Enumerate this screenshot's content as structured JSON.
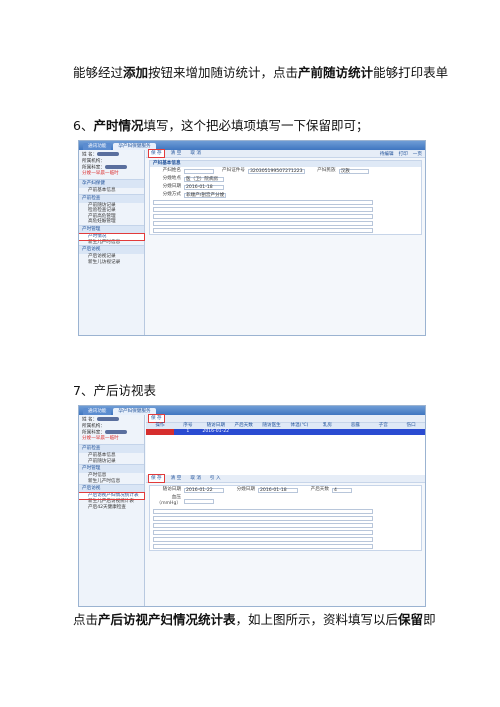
{
  "paragraphs": {
    "p1": {
      "a": "能够经过",
      "b": "添加",
      "c": "按钮来增加随访统计，点击",
      "d": "产前随访统计",
      "e": "能够打印表单"
    },
    "p2": {
      "a": "6、",
      "b": "产时情况",
      "c": "填写，这个把必填项填写一下保留即可；"
    },
    "p3": {
      "a": "7、产后访视表"
    },
    "p4": {
      "a": "点击",
      "b": "产后访视产妇情况统计表",
      "c": "，如上图所示，资料填写以后",
      "d": "保留",
      "e": "即"
    }
  },
  "screenshot1": {
    "tabs": [
      "通讯功能",
      "孕产妇保健服务"
    ],
    "user_lines": [
      "姓   名：",
      "所属机构：",
      "所属科室：",
      "分娩一早晨一临时"
    ],
    "side_heads": [
      "孕产妇保健",
      "产前检查",
      "产时管理",
      "产后访视"
    ],
    "side_items": [
      "产前基本信息",
      "产前随访记录",
      "检验检查记录",
      "产前高危管理",
      "高危妊娠管理",
      "产时信息",
      "产后访视记录",
      "新生儿产时信息",
      "新生儿访视记录"
    ],
    "highlight_item": "产时情况",
    "toolbar": [
      "保 存",
      "清 空",
      "取 消"
    ],
    "topright": [
      "待编辑",
      "打印",
      "一页"
    ],
    "section_title": "产妇基本信息",
    "fields": [
      {
        "label": "产妇姓名",
        "value": ""
      },
      {
        "label": "产妇证件号",
        "value": "320305199507271223"
      },
      {
        "label": "产妇民族",
        "value": "汉族"
      },
      {
        "label": "分娩地点",
        "value": "医（卫）院病房"
      },
      {
        "label": "分娩日期",
        "value": "2016-01-18"
      },
      {
        "label": "分娩方式",
        "value": "非顺产/剖宫产分娩"
      }
    ]
  },
  "screenshot2": {
    "tabs": [
      "通讯功能",
      "孕产妇保健服务"
    ],
    "grid_headers": [
      "操作",
      "序号",
      "随访日期",
      "产后天数",
      "随访医生",
      "体温(℃)",
      "乳房",
      "恶露",
      "子宫",
      "伤口"
    ],
    "grid_row": [
      "",
      "1",
      "2016-01-22",
      "",
      "",
      "",
      "",
      "",
      "",
      ""
    ],
    "toolbar": [
      "保 存",
      "清 空",
      "取 消",
      "引 入"
    ],
    "side_items": [
      "产前基本信息",
      "产前随访记录",
      "产时信息",
      "新生儿产时信息",
      "产后访视产妇情况统计表",
      "新生儿产后访视统计表",
      "产后42天健康检查"
    ],
    "highlight_item": "产后访视产妇情况统计表",
    "fields": [
      {
        "label": "随访日期",
        "value": "2016-01-22"
      },
      {
        "label": "分娩日期",
        "value": "2016-01-18"
      },
      {
        "label": "产后天数",
        "value": "4"
      },
      {
        "label": "血压（mmHg）",
        "value": ""
      }
    ]
  }
}
